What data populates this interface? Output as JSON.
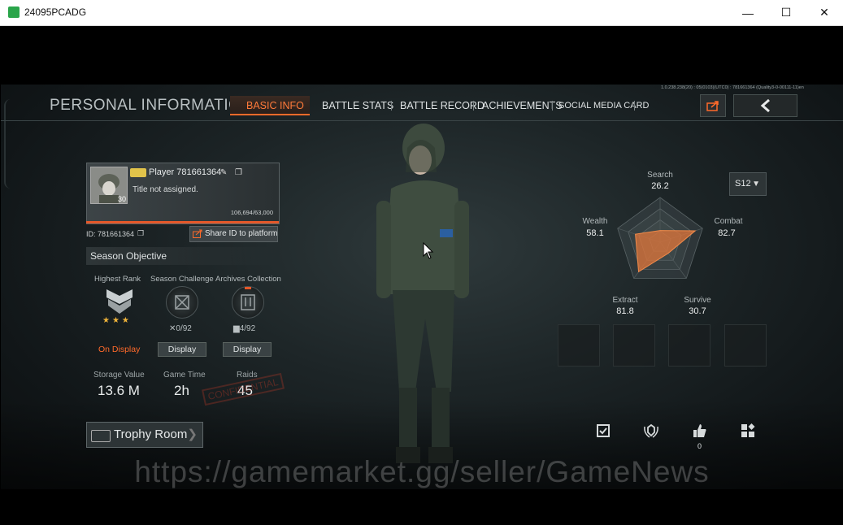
{
  "window": {
    "title": "24095PCADG",
    "minimize": "—",
    "maximize": "☐",
    "close": "✕"
  },
  "header": {
    "page_title": "PERSONAL INFORMATION",
    "tabs": [
      {
        "label": "BASIC INFO",
        "active": true
      },
      {
        "label": "BATTLE STATS",
        "active": false
      },
      {
        "label": "BATTLE RECORD",
        "active": false
      },
      {
        "label": "ACHIEVEMENTS",
        "active": false
      },
      {
        "label": "SOCIAL MEDIA CARD",
        "active": false
      }
    ],
    "ip_info": "1.0.238.238(20) : 05(0103)(UTC0) : 781661364 (Quality3-0-00111-11)en"
  },
  "profile": {
    "player_name": "Player  781661364",
    "level": "30",
    "title_text": "Title not assigned.",
    "xp": "106,694/63,000",
    "id_label": "ID:  781661364",
    "share_id_label": "Share ID to platform"
  },
  "season_objective": {
    "header": "Season Objective",
    "columns": [
      {
        "label": "Highest Rank",
        "count": "",
        "action": "On Display"
      },
      {
        "label": "Season Challenge",
        "count": "✕0/92",
        "action": "Display"
      },
      {
        "label": "Archives Collection",
        "count": "▆4/92",
        "action": "Display"
      }
    ],
    "stars": "★★★"
  },
  "stats": [
    {
      "label": "Storage Value",
      "value": "13.6 M"
    },
    {
      "label": "Game Time",
      "value": "2h"
    },
    {
      "label": "Raids",
      "value": "45"
    }
  ],
  "stamp_text": "CONFIDENTIAL",
  "trophy_room": {
    "label": "Trophy Room"
  },
  "radar": {
    "season": "S12",
    "axes": [
      {
        "name": "Search",
        "value": "26.2"
      },
      {
        "name": "Combat",
        "value": "82.7"
      },
      {
        "name": "Survive",
        "value": "30.7"
      },
      {
        "name": "Extract",
        "value": "81.8"
      },
      {
        "name": "Wealth",
        "value": "58.1"
      }
    ],
    "fill_color": "#e2763a"
  },
  "likes": {
    "count": "0"
  },
  "watermark": "https://gamemarket.gg/seller/GameNews",
  "colors": {
    "accent": "#ff6a2a",
    "text": "#e7eaeb"
  }
}
